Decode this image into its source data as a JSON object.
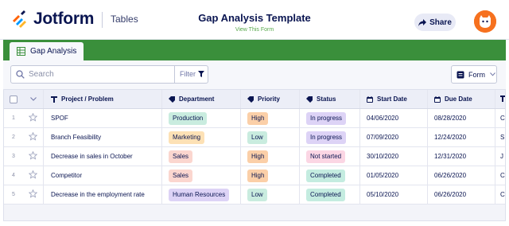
{
  "header": {
    "brand": "Jotform",
    "app_name": "Tables",
    "doc_title": "Gap Analysis Template",
    "view_link": "View This Form",
    "share_label": "Share"
  },
  "tab": {
    "label": "Gap Analysis"
  },
  "toolbar": {
    "search_placeholder": "Search",
    "filter_label": "Filter",
    "form_label": "Form"
  },
  "table": {
    "columns": {
      "name": "Project / Problem",
      "department": "Department",
      "priority": "Priority",
      "status": "Status",
      "start": "Start Date",
      "due": "Due Date"
    },
    "rows": [
      {
        "num": "1",
        "name": "SPOF",
        "department": "Production",
        "priority": "High",
        "status": "In progress",
        "start": "04/06/2020",
        "due": "08/28/2020",
        "more": "C"
      },
      {
        "num": "2",
        "name": "Branch Feasibility",
        "department": "Marketing",
        "priority": "Low",
        "status": "In progress",
        "start": "07/09/2020",
        "due": "12/24/2020",
        "more": "S"
      },
      {
        "num": "3",
        "name": "Decrease in sales in October",
        "department": "Sales",
        "priority": "High",
        "status": "Not started",
        "start": "30/10/2020",
        "due": "12/31/2020",
        "more": "J"
      },
      {
        "num": "4",
        "name": "Competitor",
        "department": "Sales",
        "priority": "High",
        "status": "Completed",
        "start": "01/05/2020",
        "due": "06/26/2020",
        "more": "C"
      },
      {
        "num": "5",
        "name": "Decrease in the employment rate",
        "department": "Human Resources",
        "priority": "Low",
        "status": "Completed",
        "start": "05/10/2020",
        "due": "06/26/2020",
        "more": "C"
      }
    ]
  },
  "colors": {
    "accent_green": "#3a8f3b",
    "brand_orange": "#f6711f",
    "dept": {
      "Production": "#c9ecdf",
      "Marketing": "#fde1b5",
      "Sales": "#fbd6cf",
      "Human Resources": "#ddd3f6"
    },
    "priority": {
      "High": "#fbcfa8",
      "Low": "#c9ecdf"
    },
    "status": {
      "In progress": "#ddd3f6",
      "Not started": "#fbd6e4",
      "Completed": "#c4ece0"
    }
  }
}
